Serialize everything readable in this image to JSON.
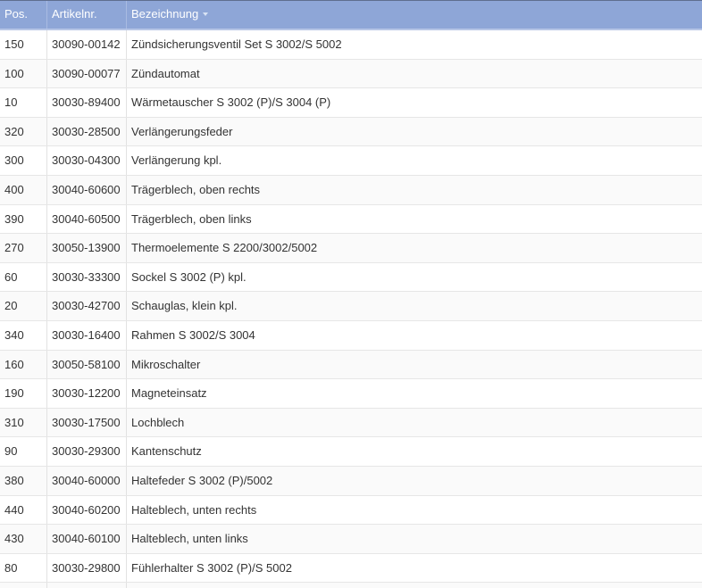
{
  "table": {
    "columns": [
      {
        "label": "Pos."
      },
      {
        "label": "Artikelnr."
      },
      {
        "label": "Bezeichnung",
        "sort_icon": "chevron-down-icon"
      }
    ],
    "rows": [
      {
        "pos": "150",
        "artikelnr": "30090-00142",
        "bezeichnung": "Zündsicherungsventil Set S 3002/S 5002"
      },
      {
        "pos": "100",
        "artikelnr": "30090-00077",
        "bezeichnung": "Zündautomat"
      },
      {
        "pos": "10",
        "artikelnr": "30030-89400",
        "bezeichnung": "Wärmetauscher S 3002 (P)/S 3004 (P)"
      },
      {
        "pos": "320",
        "artikelnr": "30030-28500",
        "bezeichnung": "Verlängerungsfeder"
      },
      {
        "pos": "300",
        "artikelnr": "30030-04300",
        "bezeichnung": "Verlängerung kpl."
      },
      {
        "pos": "400",
        "artikelnr": "30040-60600",
        "bezeichnung": "Trägerblech, oben rechts"
      },
      {
        "pos": "390",
        "artikelnr": "30040-60500",
        "bezeichnung": "Trägerblech, oben links"
      },
      {
        "pos": "270",
        "artikelnr": "30050-13900",
        "bezeichnung": "Thermoelemente S 2200/3002/5002"
      },
      {
        "pos": "60",
        "artikelnr": "30030-33300",
        "bezeichnung": "Sockel S 3002 (P) kpl."
      },
      {
        "pos": "20",
        "artikelnr": "30030-42700",
        "bezeichnung": "Schauglas, klein kpl."
      },
      {
        "pos": "340",
        "artikelnr": "30030-16400",
        "bezeichnung": "Rahmen S 3002/S 3004"
      },
      {
        "pos": "160",
        "artikelnr": "30050-58100",
        "bezeichnung": "Mikroschalter"
      },
      {
        "pos": "190",
        "artikelnr": "30030-12200",
        "bezeichnung": "Magneteinsatz"
      },
      {
        "pos": "310",
        "artikelnr": "30030-17500",
        "bezeichnung": "Lochblech"
      },
      {
        "pos": "90",
        "artikelnr": "30030-29300",
        "bezeichnung": "Kantenschutz"
      },
      {
        "pos": "380",
        "artikelnr": "30040-60000",
        "bezeichnung": "Haltefeder S 3002 (P)/5002"
      },
      {
        "pos": "440",
        "artikelnr": "30040-60200",
        "bezeichnung": "Halteblech, unten rechts"
      },
      {
        "pos": "430",
        "artikelnr": "30040-60100",
        "bezeichnung": "Halteblech, unten links"
      },
      {
        "pos": "80",
        "artikelnr": "30030-29800",
        "bezeichnung": "Fühlerhalter S 3002 (P)/S 5002"
      },
      {
        "pos": "",
        "artikelnr": "",
        "bezeichnung": ""
      }
    ]
  },
  "colors": {
    "header_bg": "#8ea6d7",
    "header_text": "#ffffff",
    "row_alt_bg": "#fafafa",
    "row_text": "#333333",
    "grid_line": "#e2e2e2"
  }
}
